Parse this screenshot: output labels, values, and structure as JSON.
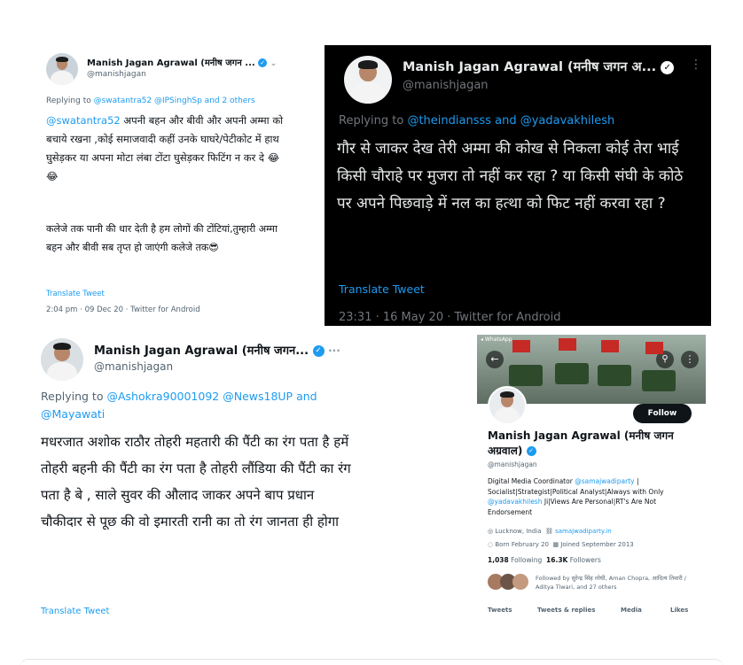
{
  "tweet1": {
    "name": "Manish Jagan Agrawal (मनीष जगन ...",
    "handle": "@manishjagan",
    "replying_prefix": "Replying to ",
    "replying_to": "@swatantra52 @IPSinghSp and 2 others",
    "mention": "@swatantra52",
    "body_line1": " अपनी बहन और बीवी और",
    "body_rest": "अपनी अम्मा को बचाये रखना ,कोई समाजवादी कहीं उनके घाघरे/पेटीकोट में हाथ घुसेड़कर या अपना मोटा लंबा टोंटा घुसेड़कर फिटिंग न कर दे 😂😂",
    "body_para2": "कलेजे तक पानी की धार देती है हम लोगों की टोंटियां,तुम्हारी अम्मा बहन और बीवी सब तृप्त हो जाएंगी कलेजे तक😎",
    "translate": "Translate Tweet",
    "timestamp": "2:04 pm · 09 Dec 20 · Twitter for Android"
  },
  "tweet2": {
    "name": "Manish Jagan Agrawal (मनीष जगन अ...",
    "handle": "@manishjagan",
    "replying_prefix": "Replying to ",
    "replying_to": "@theindiansss and @yadavakhilesh",
    "body": "गौर से जाकर देख तेरी अम्मा की कोख से निकला कोई तेरा भाई किसी चौराहे पर मुजरा तो नहीं कर रहा ? या किसी संघी के कोठे पर अपने पिछवाड़े में नल का हत्था को फिट नहीं करवा रहा ?",
    "translate": "Translate Tweet",
    "timestamp": "23:31 · 16 May 20 · Twitter for Android"
  },
  "tweet3": {
    "name": "Manish Jagan Agrawal (मनीष जगन...",
    "handle": "@manishjagan",
    "replying_prefix": "Replying to ",
    "replying_to": "@Ashokra90001092 @News18UP and @Mayawati",
    "body": "मधरजात अशोक राठौर तोहरी महतारी की पैंटी का रंग पता है हमें तोहरी बहनी की पैंटी का रंग पता है तोहरी लौंडिया की पैंटी का रंग पता है बे , साले सुवर की औलाद जाकर अपने बाप प्रधान चौकीदार से पूछ की वो इमारती रानी का तो रंग जानता ही होगा",
    "translate": "Translate Tweet"
  },
  "profile": {
    "status_app": "WhatsApp",
    "follow": "Follow",
    "name": "Manish Jagan Agrawal (मनीष जगन अग्रवाल)",
    "handle": "@manishjagan",
    "bio_prefix": "Digital Media Coordinator ",
    "bio_link1": "@samajwadiparty",
    "bio_mid": " | Socialist|Strategist|Political Analyst|Always with Only ",
    "bio_link2": "@yadavakhilesh",
    "bio_suffix": " Ji|Views Are Personal|RT's Are Not Endorsement",
    "location": "Lucknow, India",
    "website": "samajwadiparty.in",
    "born": "Born February 20",
    "joined": "Joined September 2013",
    "following_count": "1,038",
    "following_label": "Following",
    "followers_count": "16.3K",
    "followers_label": "Followers",
    "followed_by": "Followed by सुरेन्द्र सिंह लोधी, Aman Chopra, आदित्य तिवारी / Aditya Tiwari, and 27 others",
    "tabs": [
      "Tweets",
      "Tweets & replies",
      "Media",
      "Likes"
    ]
  },
  "colors": {
    "link": "#1d9bf0",
    "verified": "#1d9bf0",
    "dark_bg": "#000000",
    "muted": "#536471"
  }
}
